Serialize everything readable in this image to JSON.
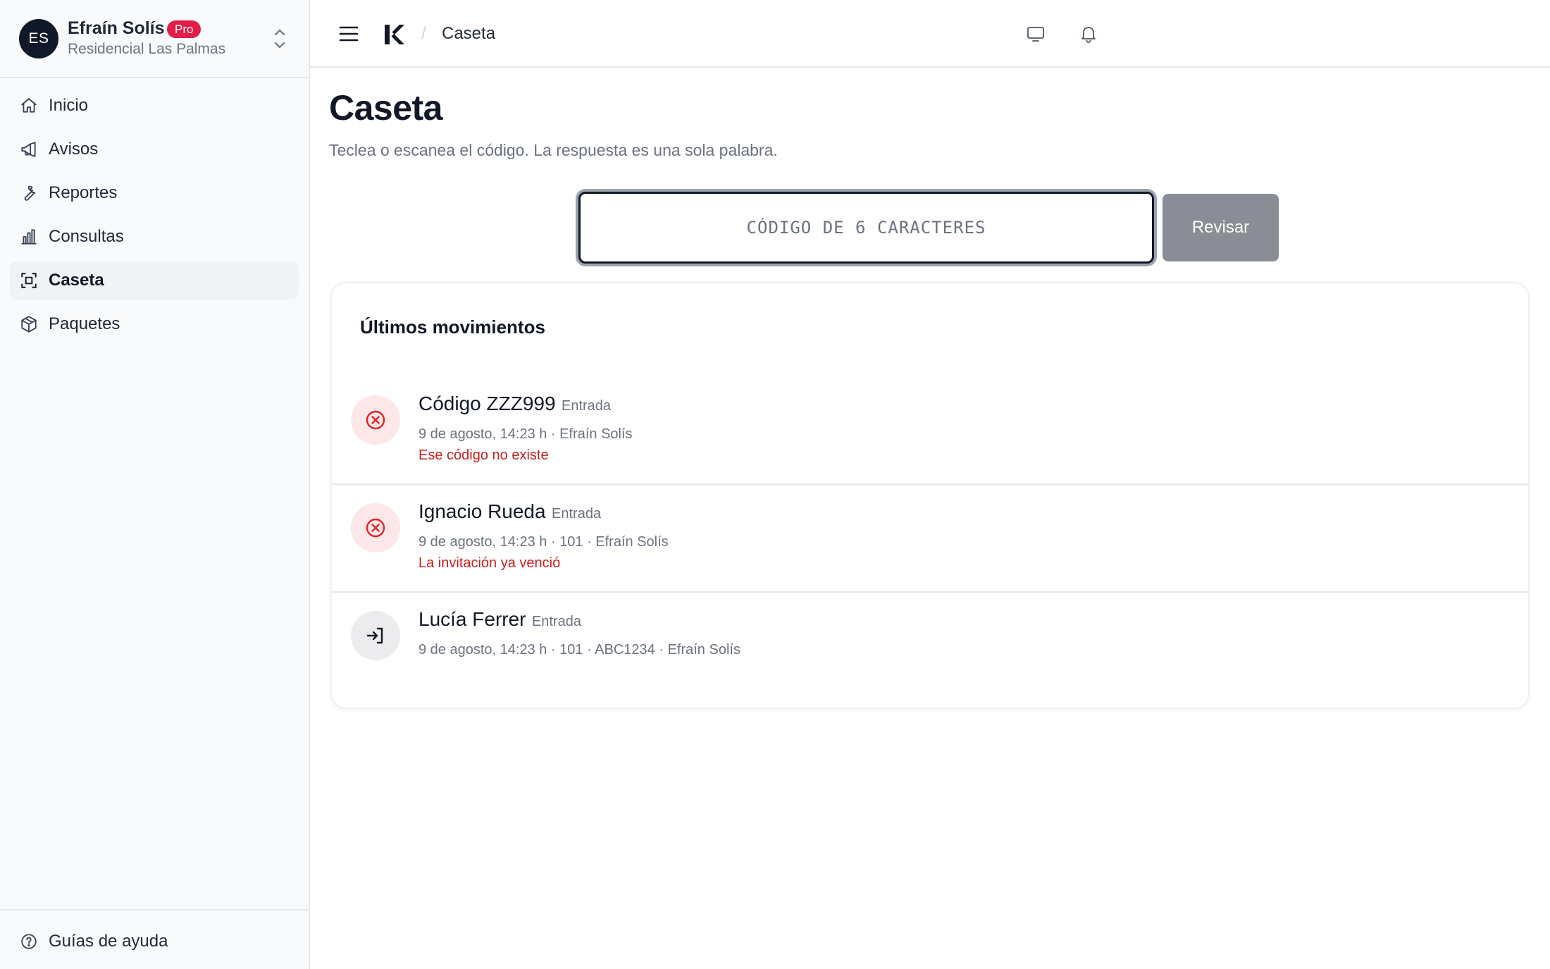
{
  "account": {
    "initials": "ES",
    "name": "Efraín Solís",
    "badge": "Pro",
    "community": "Residencial Las Palmas"
  },
  "sidebar": {
    "items": [
      {
        "label": "Inicio",
        "icon": "home-icon"
      },
      {
        "label": "Avisos",
        "icon": "megaphone-icon"
      },
      {
        "label": "Reportes",
        "icon": "wrench-icon"
      },
      {
        "label": "Consultas",
        "icon": "bar-chart-icon"
      },
      {
        "label": "Caseta",
        "icon": "scan-icon",
        "active": true
      },
      {
        "label": "Paquetes",
        "icon": "package-icon"
      }
    ],
    "footer": {
      "label": "Guías de ayuda",
      "icon": "help-circle-icon"
    }
  },
  "topbar": {
    "breadcrumb_separator": "/",
    "breadcrumb": "Caseta"
  },
  "page": {
    "title": "Caseta",
    "subtitle": "Teclea o escanea el código. La respuesta es una sola palabra."
  },
  "code_form": {
    "placeholder": "CÓDIGO DE 6 CARACTERES",
    "value": "",
    "button_label": "Revisar"
  },
  "movements": {
    "title": "Últimos movimientos",
    "items": [
      {
        "name": "Código ZZZ999",
        "kind": "Entrada",
        "meta": "9 de agosto, 14:23 h · Efraín Solís",
        "error": "Ese código no existe",
        "status": "error"
      },
      {
        "name": "Ignacio Rueda",
        "kind": "Entrada",
        "meta": "9 de agosto, 14:23 h · 101 · Efraín Solís",
        "error": "La invitación ya venció",
        "status": "error"
      },
      {
        "name": "Lucía Ferrer",
        "kind": "Entrada",
        "meta": "9 de agosto, 14:23 h · 101 · ABC1234 · Efraín Solís",
        "error": "",
        "status": "ok"
      }
    ]
  },
  "colors": {
    "accent_dark": "#111827",
    "badge_red": "#e11d48",
    "error_red": "#c81e1e",
    "button_gray": "#8a8d95"
  }
}
